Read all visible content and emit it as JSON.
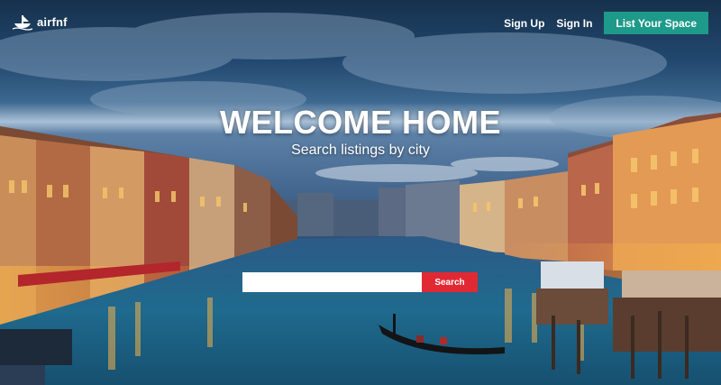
{
  "brand": {
    "name": "airfnf",
    "logo_icon": "boat-logo-icon"
  },
  "nav": {
    "sign_up_label": "Sign Up",
    "sign_in_label": "Sign In",
    "list_space_label": "List Your Space"
  },
  "hero": {
    "title": "WELCOME HOME",
    "subtitle": "Search listings by city",
    "background": "Venice Grand Canal at dusk with gondola"
  },
  "search": {
    "input_value": "",
    "placeholder": "",
    "button_label": "Search"
  },
  "colors": {
    "cta_teal": "#1e9a8a",
    "search_red": "#e12933",
    "text_white": "#ffffff"
  }
}
